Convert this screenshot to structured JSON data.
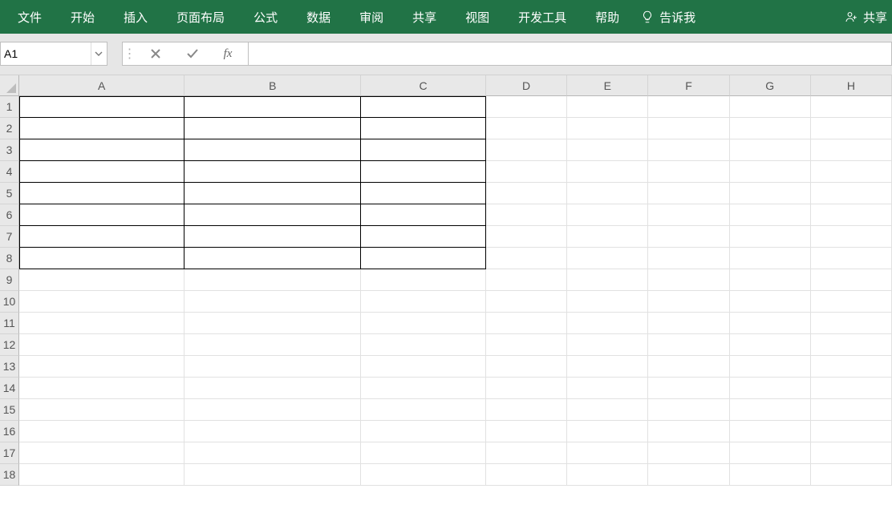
{
  "menu": {
    "items": [
      "文件",
      "开始",
      "插入",
      "页面布局",
      "公式",
      "数据",
      "审阅",
      "共享",
      "视图",
      "开发工具",
      "帮助"
    ],
    "tell_me": "告诉我",
    "share": "共享"
  },
  "formula_bar": {
    "name_box": "A1",
    "fx_label": "fx",
    "formula": ""
  },
  "grid": {
    "columns": [
      "A",
      "B",
      "C",
      "D",
      "E",
      "F",
      "G",
      "H"
    ],
    "rows": [
      "1",
      "2",
      "3",
      "4",
      "5",
      "6",
      "7",
      "8",
      "9",
      "10",
      "11",
      "12",
      "13",
      "14",
      "15",
      "16",
      "17",
      "18"
    ],
    "bordered_region": {
      "cols": [
        "A",
        "B",
        "C"
      ],
      "rows_from": 1,
      "rows_to": 8
    },
    "active_cell": "A1"
  }
}
